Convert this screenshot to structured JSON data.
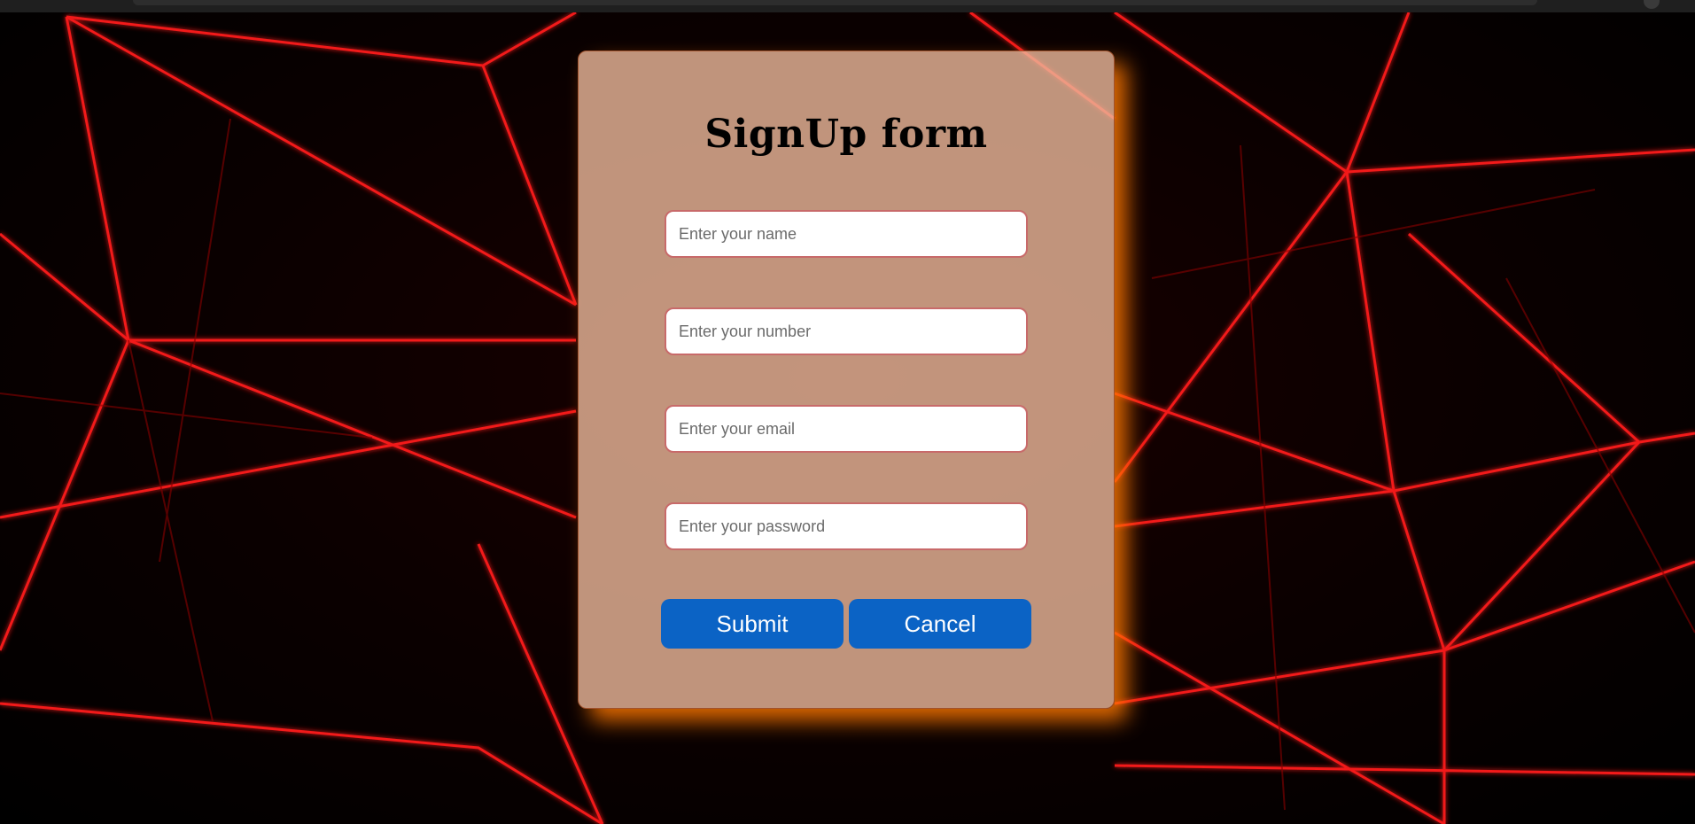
{
  "form": {
    "title": "SignUp form",
    "fields": [
      {
        "name": "name-field",
        "placeholder": "Enter your name",
        "value": ""
      },
      {
        "name": "number-field",
        "placeholder": "Enter your number",
        "value": ""
      },
      {
        "name": "email-field",
        "placeholder": "Enter your email",
        "value": ""
      },
      {
        "name": "password-field",
        "placeholder": "Enter your password",
        "value": ""
      }
    ],
    "submit_label": "Submit",
    "cancel_label": "Cancel"
  },
  "colors": {
    "card_background": "#eeb99b",
    "card_glow": "#ff7800",
    "button": "#0b63c5",
    "field_border": "#c86a6a",
    "background_lines": "#ff1a1a"
  }
}
